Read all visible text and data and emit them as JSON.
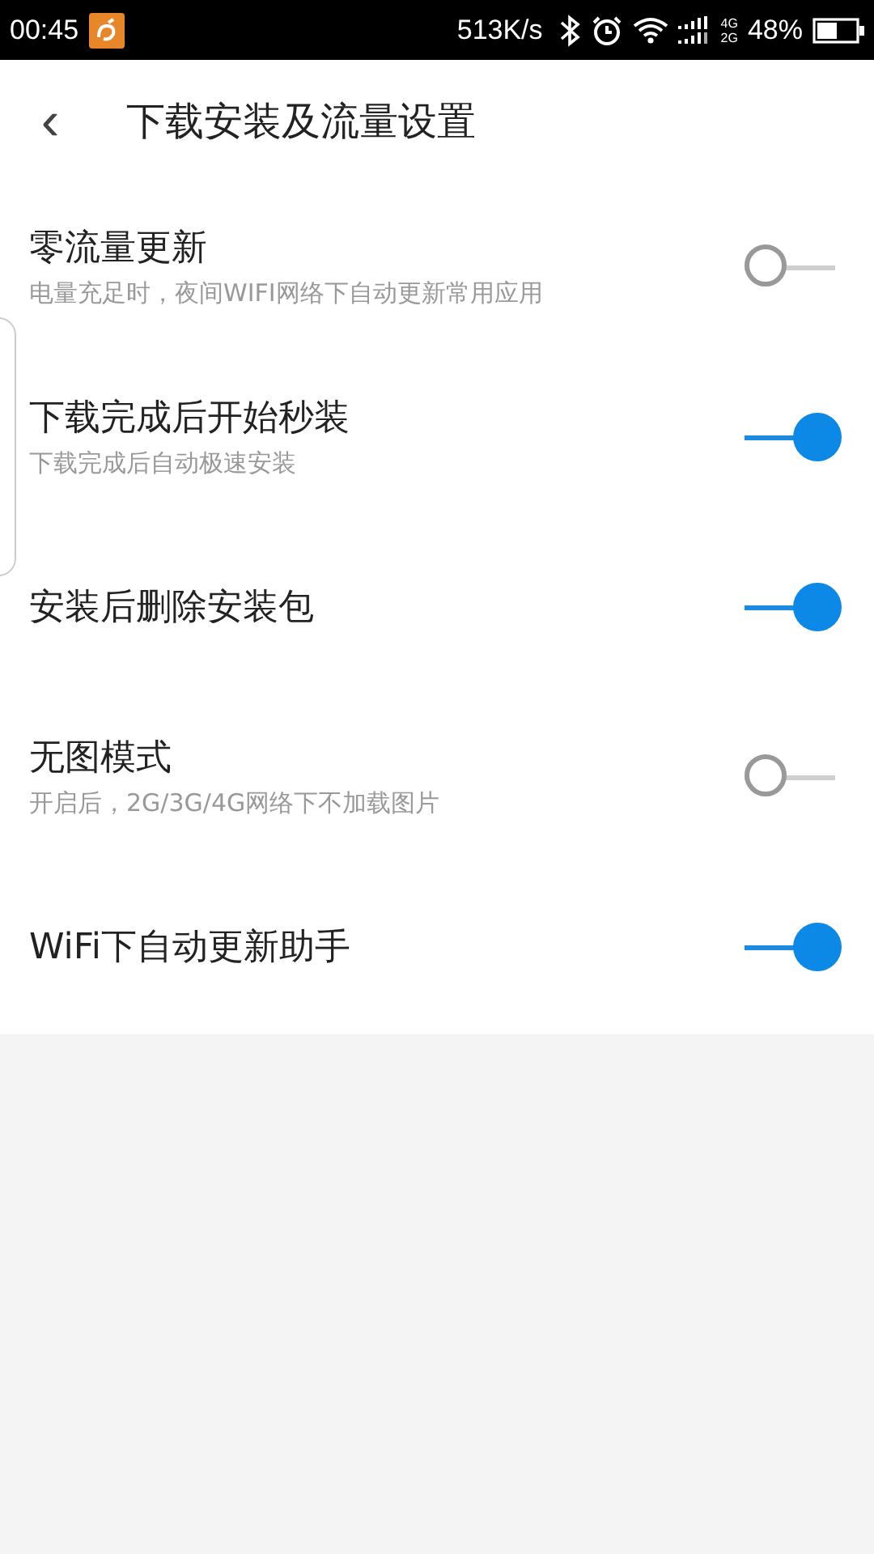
{
  "status_bar": {
    "time": "00:45",
    "speed": "513K/s",
    "network_top": "4G",
    "network_bottom": "2G",
    "battery": "48%"
  },
  "header": {
    "back": "‹",
    "title": "下载安装及流量设置"
  },
  "settings": [
    {
      "title": "零流量更新",
      "subtitle": "电量充足时，夜间WIFI网络下自动更新常用应用",
      "on": false
    },
    {
      "title": "下载完成后开始秒装",
      "subtitle": "下载完成后自动极速安装",
      "on": true
    },
    {
      "title": "安装后删除安装包",
      "on": true
    },
    {
      "title": "无图模式",
      "subtitle": "开启后，2G/3G/4G网络下不加载图片",
      "on": false
    },
    {
      "title": "WiFi下自动更新助手",
      "on": true
    }
  ]
}
